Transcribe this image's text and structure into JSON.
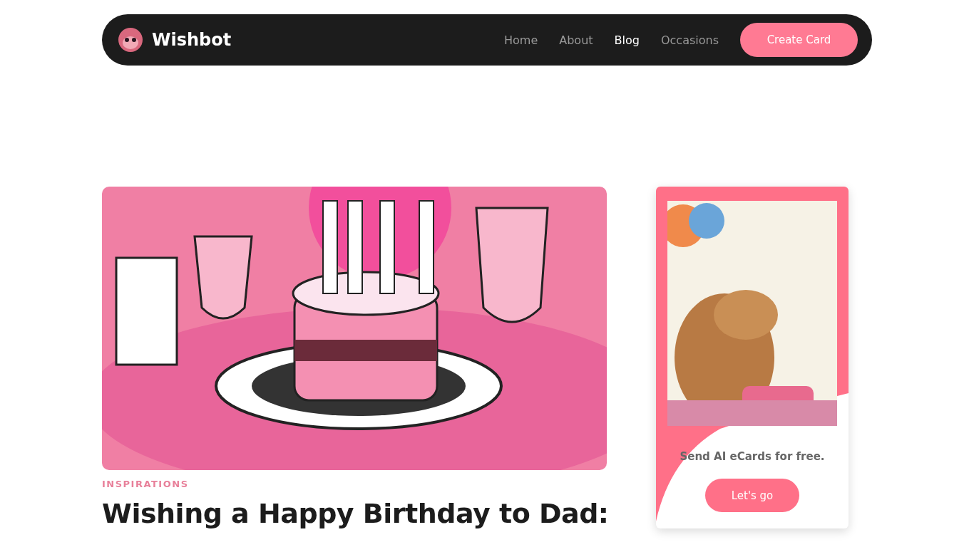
{
  "nav": {
    "brand": "Wishbot",
    "links": [
      {
        "label": "Home",
        "selected": false
      },
      {
        "label": "About",
        "selected": false
      },
      {
        "label": "Blog",
        "selected": true
      },
      {
        "label": "Occasions",
        "selected": false
      }
    ],
    "cta": "Create Card"
  },
  "article": {
    "category": "INSPIRATIONS",
    "title": "Wishing a Happy Birthday to Dad:"
  },
  "promo": {
    "text": "Send AI eCards for free.",
    "button": "Let's go"
  }
}
